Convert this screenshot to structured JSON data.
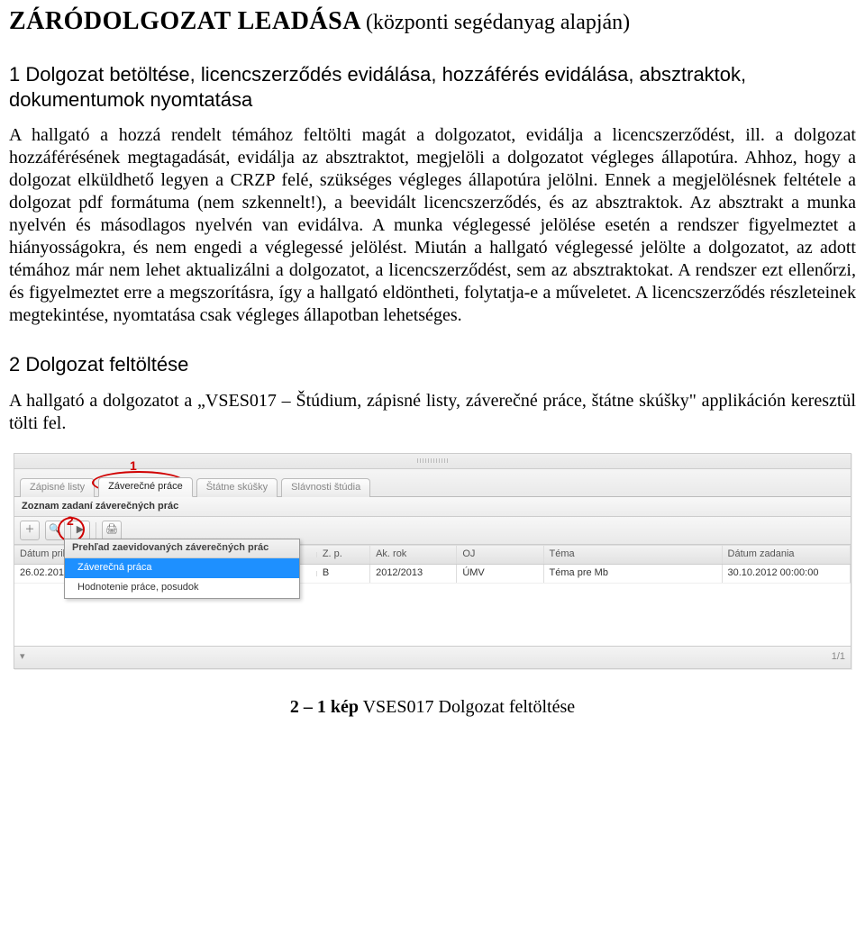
{
  "title": {
    "main": "ZÁRÓDOLGOZAT LEADÁSA",
    "paren": "(központi segédanyag alapján)"
  },
  "h1": {
    "num": "1",
    "text": "Dolgozat betöltése, licencszerződés evidálása, hozzáférés evidálása, absztraktok, dokumentumok nyomtatása"
  },
  "p1": "A hallgató a hozzá rendelt témához feltölti magát a dolgozatot, evidálja a licencszerződést, ill. a dolgozat hozzáférésének megtagadását, evidálja az absztraktot, megjelöli a dolgozatot végleges állapotúra. Ahhoz, hogy a dolgozat elküldhető legyen a CRZP felé, szükséges végleges állapotúra jelölni. Ennek a megjelölésnek feltétele a dolgozat pdf formátuma (nem szkennelt!), a beevidált licencszerződés, és az absztraktok. Az absztrakt a munka nyelvén és másodlagos nyelvén van evidálva. A munka véglegessé jelölése esetén a rendszer figyelmeztet a hiányosságokra, és nem engedi a véglegessé jelölést. Miután a hallgató véglegessé jelölte a dolgozatot, az adott témához már nem lehet aktualizálni a dolgozatot, a licencszerződést, sem az absztraktokat. A rendszer ezt ellenőrzi, és figyelmeztet erre a megszorításra, így a hallgató eldöntheti, folytatja-e a műveletet. A licencszerződés részleteinek megtekintése, nyomtatása csak végleges állapotban lehetséges.",
  "h2": {
    "num": "2",
    "text": "Dolgozat feltöltése"
  },
  "p2": "A hallgató a dolgozatot a „VSES017 – Štúdium, zápisné listy, záverečné práce, štátne skúšky\" applikáción keresztül tölti fel.",
  "screenshot": {
    "tabs": [
      "Zápisné listy",
      "Záverečné práce",
      "Štátne skúšky",
      "Slávnosti štúdia"
    ],
    "activeTab": 1,
    "sectionTitle": "Zoznam zadaní záverečných prác",
    "markers": {
      "one": "1",
      "two": "2"
    },
    "dropdown": {
      "header": "Prehľad zaevidovaných záverečných prác",
      "items": [
        "Záverečná práca",
        "Hodnotenie práce, posudok"
      ],
      "selected": 0
    },
    "gridHeaders": [
      "Dátum prihl",
      "",
      "Z. p.",
      "Ak. rok",
      "OJ",
      "Téma",
      "Dátum zadania"
    ],
    "gridRow": {
      "c1": "26.02.2013",
      "c3": "B",
      "c4": "2012/2013",
      "c5": "ÚMV",
      "c6": "Téma pre Mb",
      "c7": "30.10.2012 00:00:00"
    },
    "footerNum": "1/1"
  },
  "caption": {
    "num": "2 – 1 kép",
    "text": "VSES017 Dolgozat feltöltése"
  }
}
